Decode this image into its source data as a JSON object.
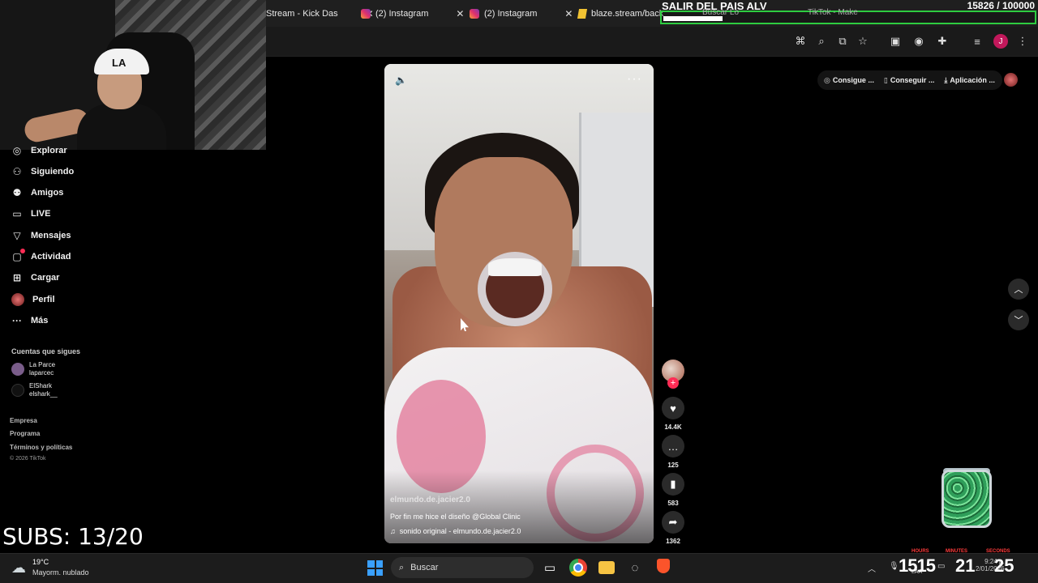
{
  "browser": {
    "tabs": [
      {
        "label": "Stream - Kick Das",
        "icon": "kick-icon"
      },
      {
        "label": "(2) Instagram",
        "icon": "instagram-icon"
      },
      {
        "label": "(2) Instagram",
        "icon": "instagram-icon"
      },
      {
        "label": "blaze.stream/back",
        "icon": "blaze-icon"
      }
    ],
    "ghost_tabs": [
      "Buscar Lo",
      "TikTok - Make"
    ]
  },
  "stream_overlay": {
    "title": "SALIR DEL PAIS ALV",
    "goal_current": "15826",
    "goal_target": "/ 100000",
    "goal_progress": 0.158,
    "subs": "SUBS: 13/20"
  },
  "sidebar": {
    "items": [
      {
        "label": "Explorar",
        "icon": "compass-icon"
      },
      {
        "label": "Siguiendo",
        "icon": "person-follow-icon"
      },
      {
        "label": "Amigos",
        "icon": "friends-icon"
      },
      {
        "label": "LIVE",
        "icon": "live-icon"
      },
      {
        "label": "Mensajes",
        "icon": "send-icon"
      },
      {
        "label": "Actividad",
        "icon": "activity-icon"
      },
      {
        "label": "Cargar",
        "icon": "upload-icon"
      },
      {
        "label": "Perfil",
        "icon": "profile-avatar"
      },
      {
        "label": "Más",
        "icon": "more-icon"
      }
    ],
    "following_title": "Cuentas que sigues",
    "following": [
      {
        "name": "La Parce",
        "handle": "laparcec"
      },
      {
        "name": "ElShark",
        "handle": "elshark__"
      }
    ],
    "footer_links": [
      "Empresa",
      "Programa",
      "Términos y políticas"
    ],
    "copyright": "© 2026 TikTok"
  },
  "video": {
    "author": "elmundo.de.jacier2.0",
    "caption": "Por fin me hice el diseño @Global Clinic",
    "sound": "sonido original - elmundo.de.jacier2.0"
  },
  "actions": {
    "likes": "14.4K",
    "comments": "125",
    "saves": "583",
    "shares": "1362"
  },
  "top_pills": [
    "Consigue ...",
    "Conseguir ...",
    "Aplicación ..."
  ],
  "taskbar": {
    "weather_temp": "19°C",
    "weather_desc": "Mayorm. nublado",
    "search_placeholder": "Buscar",
    "clock_hours": "1515",
    "clock_minutes": "21",
    "clock_seconds": "25",
    "clock_labels": [
      "HOURS",
      "MINUTES",
      "SECONDS"
    ],
    "sys_time": "9:24 p.",
    "sys_date": "2/01/2026",
    "keyboard": "LAA"
  }
}
